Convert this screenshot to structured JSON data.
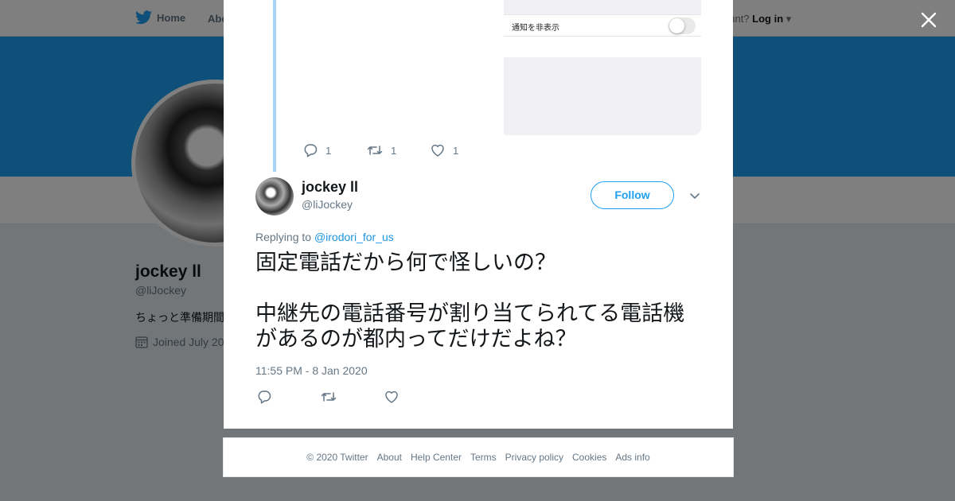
{
  "nav": {
    "home_label": "Home",
    "about_label": "Abo",
    "account_prompt": "ccount?",
    "login_label": "Log in"
  },
  "profile": {
    "name": "jockey ll",
    "handle": "@liJockey",
    "bio": "ちょっと準備期間",
    "joined": "Joined July 20"
  },
  "embedded_image": {
    "toggle_label": "通知を非表示"
  },
  "parent_tweet": {
    "reply_count": "1",
    "retweet_count": "1",
    "like_count": "1"
  },
  "tweet": {
    "author_name": "jockey ll",
    "author_handle": "@liJockey",
    "follow_label": "Follow",
    "replying_prefix": "Replying to",
    "replying_to": "@irodori_for_us",
    "text_line1": "固定電話だから何で怪しいの？",
    "text_line2": "中継先の電話番号が割り当てられてる電話機",
    "text_line3": "があるのが都内ってだけだよね？",
    "timestamp": "11:55 PM - 8 Jan 2020"
  },
  "footer": {
    "copyright": "© 2020 Twitter",
    "links": [
      "About",
      "Help Center",
      "Terms",
      "Privacy policy",
      "Cookies",
      "Ads info"
    ]
  },
  "colors": {
    "accent": "#1da1f2",
    "link": "#1b95e0",
    "thread_line": "#a8d5f5"
  }
}
